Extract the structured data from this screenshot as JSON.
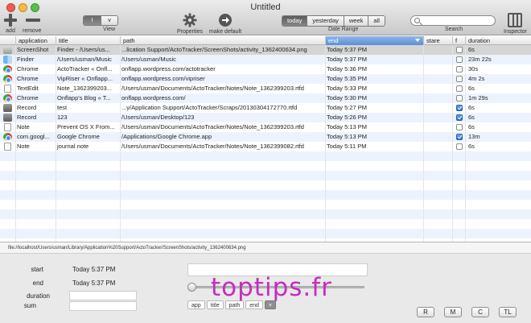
{
  "window": {
    "title": "Untitled"
  },
  "toolbar": {
    "add_label": "add",
    "remove_label": "remove",
    "view_options": [
      "I",
      "v"
    ],
    "view_label": "View",
    "properties_label": "Properties",
    "make_default_label": "make default",
    "range_options": [
      "today",
      "yesterday",
      "week",
      "all"
    ],
    "range_selected": "today",
    "range_label": "Date Range",
    "search_placeholder": "",
    "search_label": "Search",
    "inspector_label": "Inspector"
  },
  "table": {
    "columns": [
      "application",
      "title",
      "path",
      "end",
      "stare",
      "f",
      "duration"
    ],
    "sorted_column": "end",
    "rows": [
      {
        "application": "ScreenShot",
        "icon": "screenshot-icon",
        "title": "Finder - /Users/us...",
        "path": "...lication Support/ActoTracker/ScreenShots/activity_1362400634.png",
        "end": "Today 5:37 PM",
        "f": false,
        "duration": "6s"
      },
      {
        "application": "Finder",
        "icon": "finder-icon",
        "title": "/Users/usman/Music",
        "path": "/Users/usman/Music",
        "end": "Today 5:37 PM",
        "f": false,
        "duration": "23m 22s"
      },
      {
        "application": "Chrome",
        "icon": "chrome-icon",
        "title": "ActoTracker « Onfl...",
        "path": "onflapp.wordpress.com/actotracker",
        "end": "Today 5:36 PM",
        "f": false,
        "duration": "30s"
      },
      {
        "application": "Chrome",
        "icon": "chrome-icon",
        "title": "VipRiser « Onflapp...",
        "path": "onflapp.wordpress.com/vipriser",
        "end": "Today 5:35 PM",
        "f": false,
        "duration": "4m 2s"
      },
      {
        "application": "TextEdit",
        "icon": "document-icon",
        "title": "Note_1362399203...",
        "path": "/Users/usman/Documents/ActoTracker/Notes/Note_1362399203.rtfd",
        "end": "Today 5:33 PM",
        "f": false,
        "duration": "6s"
      },
      {
        "application": "Chrome",
        "icon": "chrome-icon",
        "title": "Onflapp's Blog « T...",
        "path": "onflapp.wordpress.com/",
        "end": "Today 5:30 PM",
        "f": false,
        "duration": "1m 29s"
      },
      {
        "application": "Record",
        "icon": "record-icon",
        "title": "test",
        "path": "...y/Application Support/ActoTracker/Scraps/20130304172770.rtfd",
        "end": "Today 5:27 PM",
        "f": true,
        "duration": "6s"
      },
      {
        "application": "Record",
        "icon": "record-icon",
        "title": "123",
        "path": "/Users/usman/Desktop/123",
        "end": "Today 5:26 PM",
        "f": true,
        "duration": "6s"
      },
      {
        "application": "Note",
        "icon": "document-icon",
        "title": "Prevent OS X From...",
        "path": "/Users/usman/Documents/ActoTracker/Notes/Note_1362399203.rtfd",
        "end": "Today 5:13 PM",
        "f": false,
        "duration": "6s"
      },
      {
        "application": "com.googl...",
        "icon": "chrome-icon",
        "title": "Google Chrome",
        "path": "/Applications/Google Chrome.app",
        "end": "Today 5:13 PM",
        "f": true,
        "duration": "13m"
      },
      {
        "application": "Note",
        "icon": "document-icon",
        "title": "journal note",
        "path": "/Users/usman/Documents/ActoTracker/Notes/Note_1362399082.rtfd",
        "end": "Today 5:11 PM",
        "f": false,
        "duration": "6s"
      }
    ]
  },
  "status": {
    "path": "file://localhost/Users/usman/Library/Application%20Support/ActoTracker/ScreenShots/activity_1362400634.png"
  },
  "inspector": {
    "start_label": "start",
    "start_value": "Today 5:37 PM",
    "end_label": "end",
    "end_value": "Today 5:37 PM",
    "duration_label": "duration",
    "sum_label": "sum",
    "slider_level": 0,
    "tokens": [
      "app",
      "title",
      "path",
      "end",
      "×"
    ],
    "buttons": [
      "R",
      "M",
      "C",
      "TL"
    ]
  },
  "watermark": "toptips.fr"
}
